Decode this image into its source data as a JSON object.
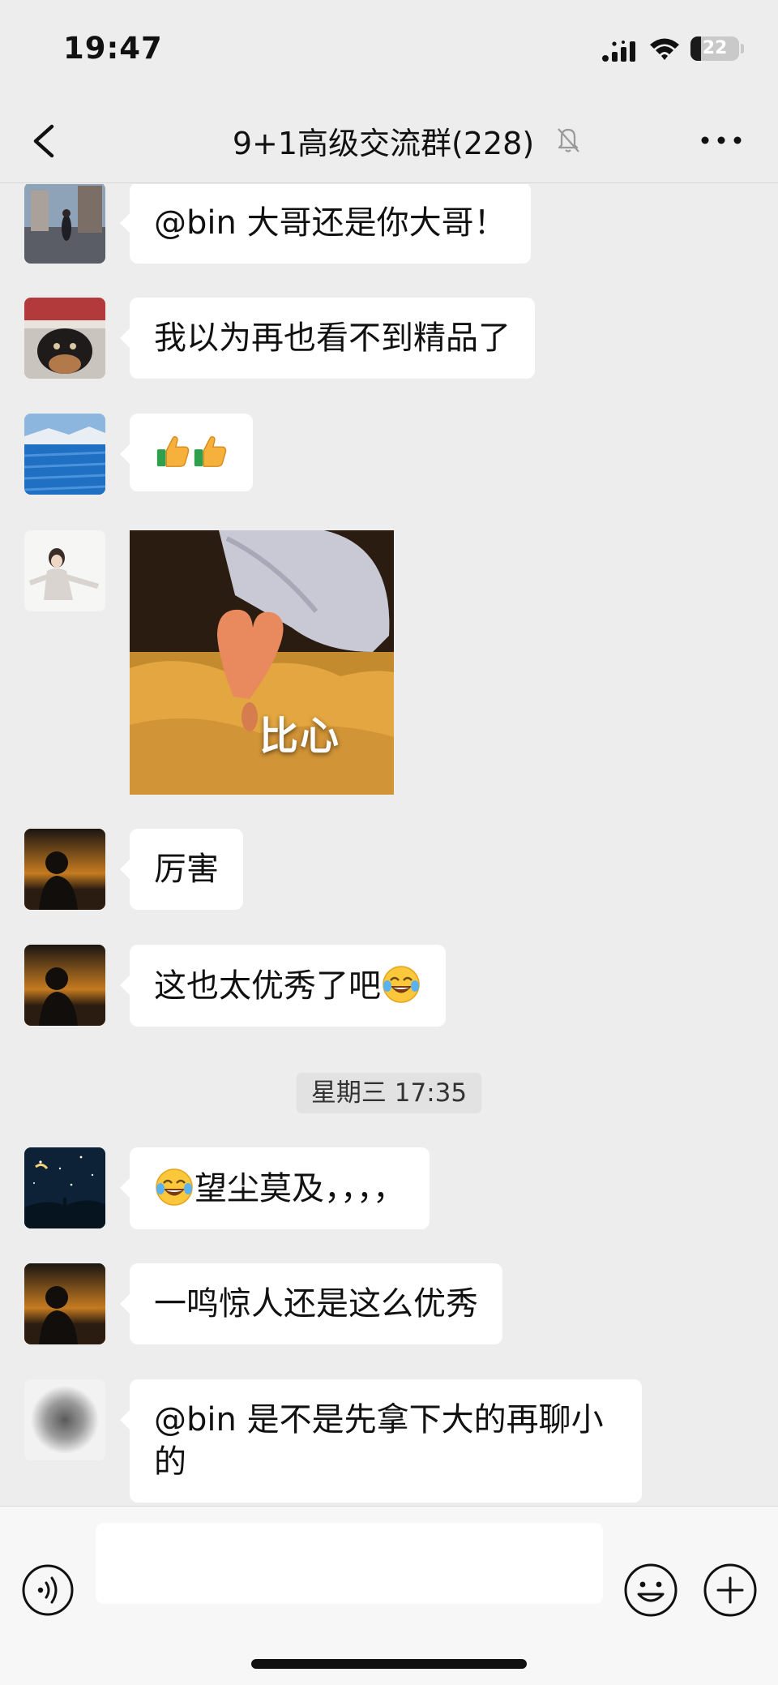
{
  "status_bar": {
    "time": "19:47",
    "battery_level": "22",
    "icons": [
      "cellular-signal-icon",
      "wifi-icon",
      "battery-icon"
    ]
  },
  "nav": {
    "title": "9+1高级交流群(228)",
    "icons": [
      "back-arrow-icon",
      "bell-muted-icon",
      "more-dots-icon"
    ]
  },
  "messages": [
    {
      "type": "text",
      "text": "@bin 大哥还是你大哥！"
    },
    {
      "type": "text",
      "text": "我以为再也看不到精品了"
    },
    {
      "type": "emoji",
      "emoji_count": 2,
      "emoji_name": "thumbs-up-icon"
    },
    {
      "type": "sticker",
      "caption": "比心"
    },
    {
      "type": "text",
      "text": "厉害"
    },
    {
      "type": "text",
      "text": "这也太优秀了吧",
      "trailing_emoji": "tears-of-joy-icon"
    },
    {
      "type": "text",
      "text": "望尘莫及，，，，",
      "leading_emoji": "tears-of-joy-icon"
    },
    {
      "type": "text",
      "text": "一鸣惊人还是这么优秀"
    },
    {
      "type": "text",
      "text_line1": "@bin 是不是先拿下大的再聊小",
      "text_line2": "的"
    }
  ],
  "timestamp": "星期三 17:35",
  "input_bar": {
    "value": "",
    "icons": [
      "voice-input-icon",
      "emoji-face-icon",
      "plus-circle-icon"
    ]
  },
  "colors": {
    "background": "#ededed",
    "bubble": "#ffffff",
    "text": "#111111"
  }
}
